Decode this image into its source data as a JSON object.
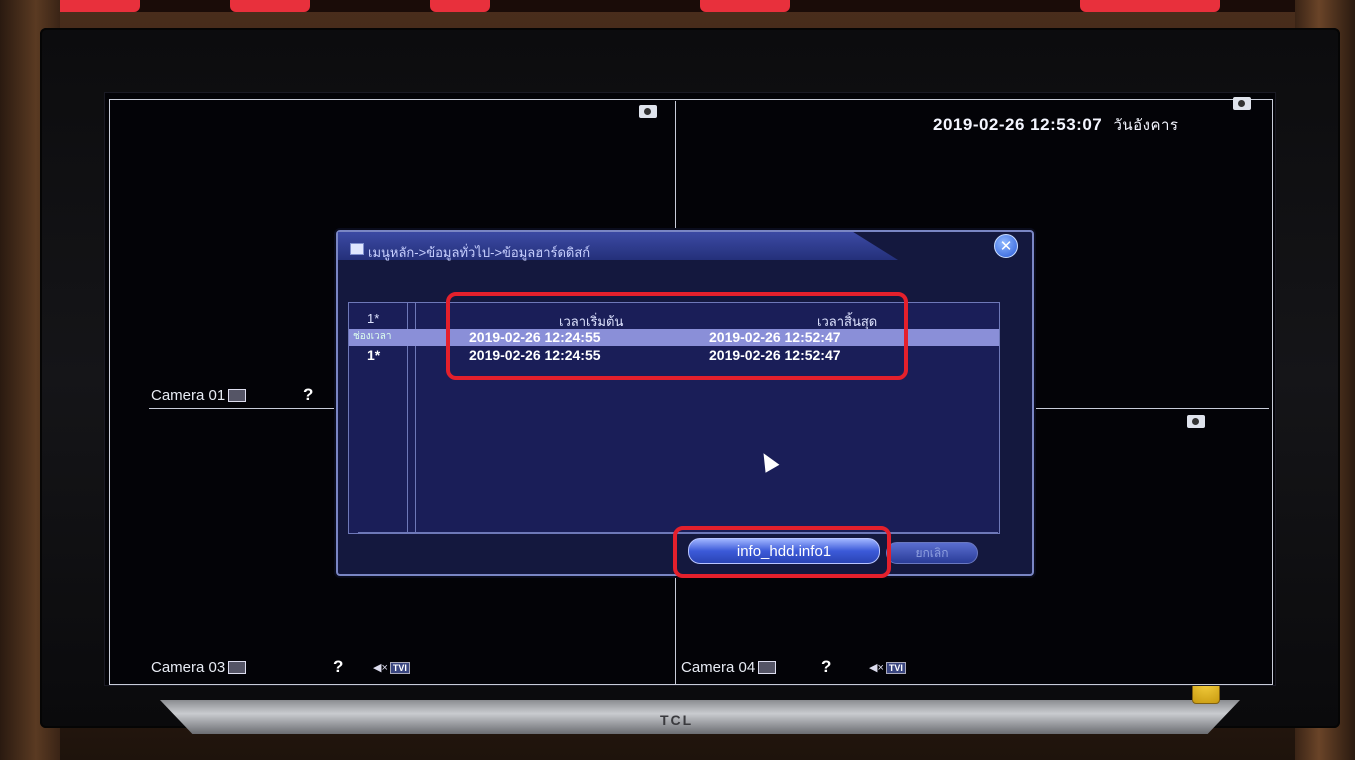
{
  "screen": {
    "datetime": "2019-02-26 12:53:07",
    "weekday": "วันอังคาร",
    "cameras": [
      {
        "label": "Camera 01"
      },
      {
        "label": "Camera 03"
      },
      {
        "label": "Camera 04"
      }
    ],
    "unknown_symbol": "?",
    "tvi_label": "TVI",
    "tv_brand": "TCL"
  },
  "dialog": {
    "breadcrumb": "เมนูหลัก->ข้อมูลทั่วไป->ข้อมูลฮาร์ดดิสก์",
    "columns": {
      "index": "1*",
      "start": "เวลาเริ่มต้น",
      "end": "เวลาสิ้นสุด"
    },
    "rows": [
      {
        "index": "ช่องเวลา",
        "start": "2019-02-26 12:24:55",
        "end": "2019-02-26 12:52:47",
        "selected": true
      },
      {
        "index": "1*",
        "start": "2019-02-26 12:24:55",
        "end": "2019-02-26 12:52:47",
        "selected": false
      }
    ],
    "buttons": {
      "info": "info_hdd.info1",
      "cancel": "ยกเลิก"
    },
    "close_symbol": "✕"
  },
  "colors": {
    "highlight": "#e4202c",
    "dialog_bg": "#14183e",
    "selected_row": "#8a8fd8"
  }
}
